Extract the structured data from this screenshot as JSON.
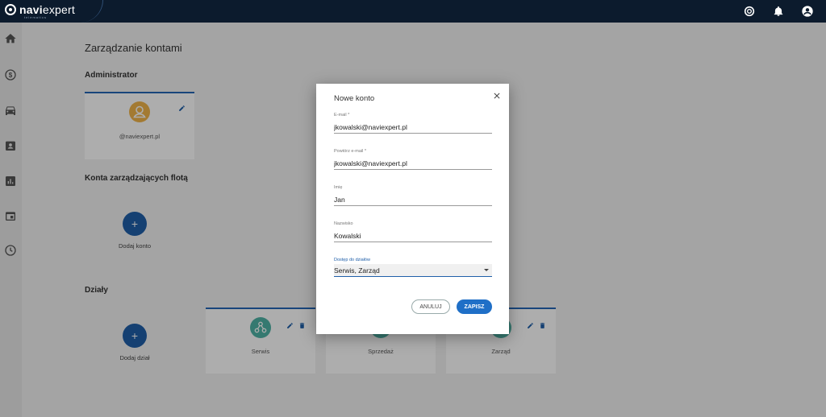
{
  "brand": {
    "name_bold": "navi",
    "name_light": "expert",
    "sub": "telematics"
  },
  "page": {
    "title": "Zarządzanie kontami",
    "admin_section": "Administrator",
    "admin_email": "@naviexpert.pl",
    "fleet_section": "Konta zarządzających flotą",
    "add_account": "Dodaj konto",
    "departments_section": "Działy",
    "add_department": "Dodaj dział",
    "departments": [
      "Serwis",
      "Sprzedaż",
      "Zarząd"
    ]
  },
  "modal": {
    "title": "Nowe konto",
    "fields": [
      {
        "label": "E-mail *",
        "value": "jkowalski@naviexpert.pl"
      },
      {
        "label": "Powtórz e-mail *",
        "value": "jkowalski@naviexpert.pl"
      },
      {
        "label": "Imię",
        "value": "Jan"
      },
      {
        "label": "Nazwisko",
        "value": "Kowalski"
      }
    ],
    "select": {
      "label": "Dostęp do działów",
      "value": "Serwis, Zarząd"
    },
    "cancel": "ANULUJ",
    "save": "ZAPISZ"
  },
  "colors": {
    "accent": "#1f6fc7",
    "topbar": "#0c1b2d",
    "avatar_admin": "#f0b44a",
    "dept_icon": "#4fb3a6"
  }
}
